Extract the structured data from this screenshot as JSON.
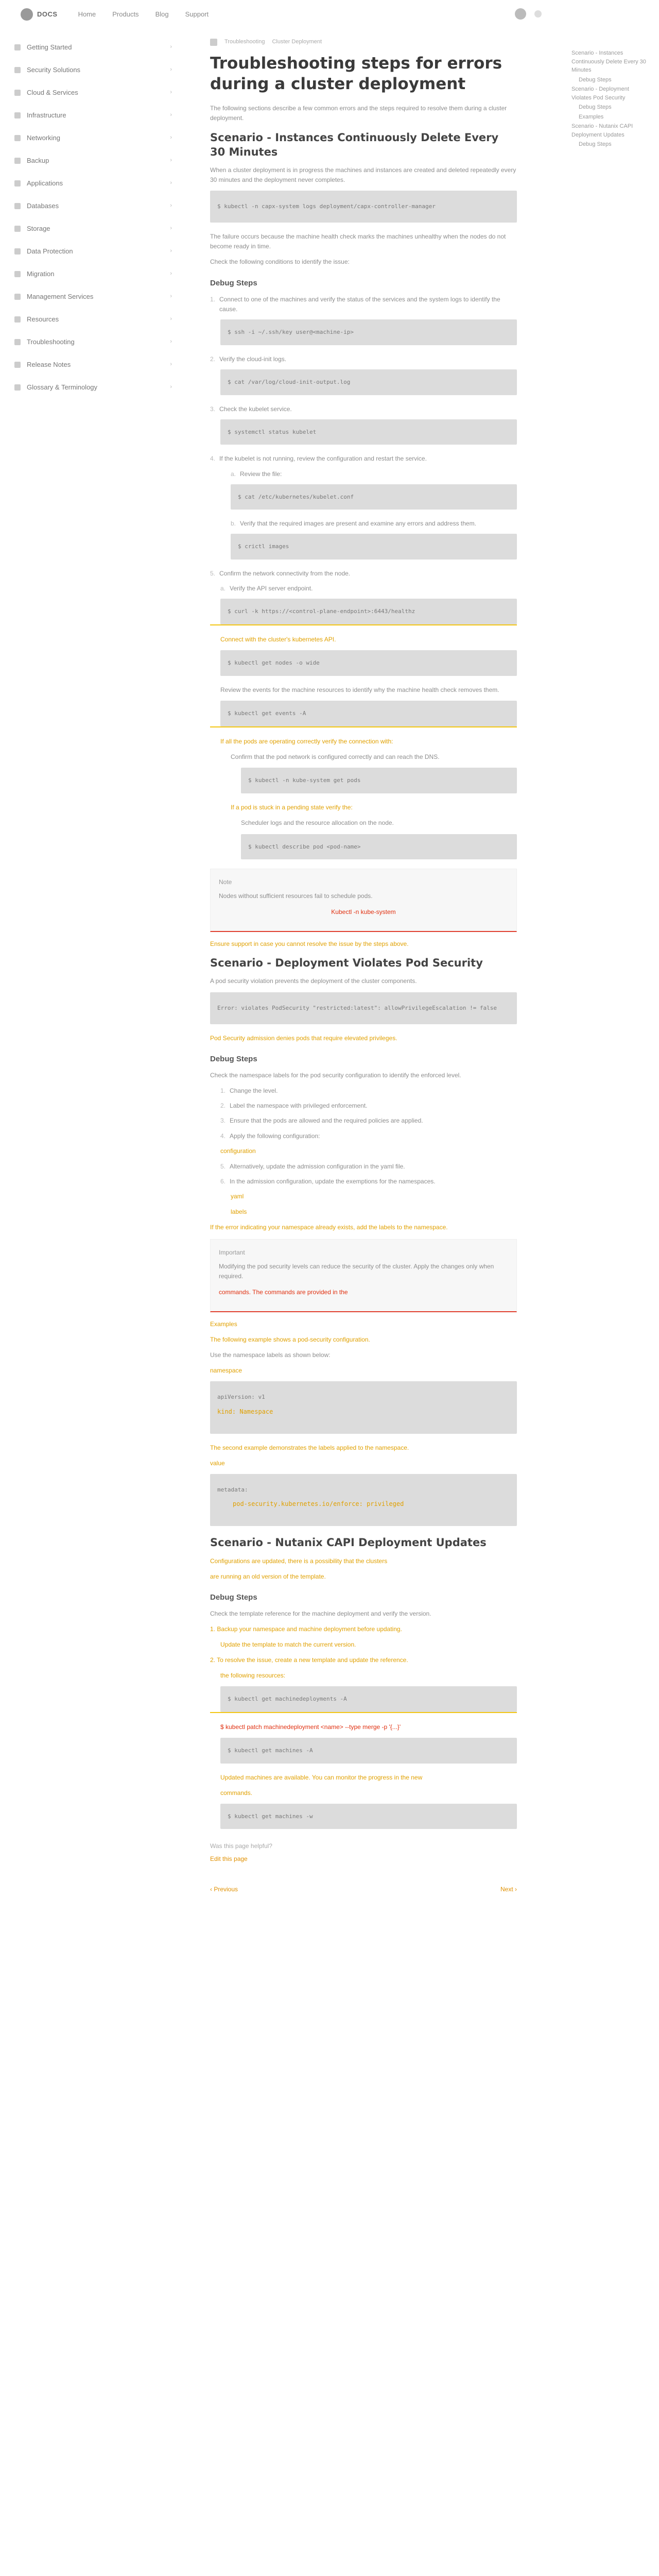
{
  "nav": {
    "brand": "DOCS",
    "links": [
      "Home",
      "Products",
      "Blog",
      "Support"
    ]
  },
  "sidebar": {
    "items": [
      "Getting Started",
      "Security Solutions",
      "Cloud & Services",
      "Infrastructure",
      "Networking",
      "Backup",
      "Applications",
      "Databases",
      "Storage",
      "Data Protection",
      "Migration",
      "Management Services",
      "Resources",
      "Troubleshooting",
      "Release Notes",
      "Glossary & Terminology"
    ]
  },
  "breadcrumb": [
    "Troubleshooting",
    "Cluster Deployment"
  ],
  "page": {
    "title": "Troubleshooting steps for errors during a cluster deployment",
    "intro": "The following sections describe a few common errors and the steps required to resolve them during a cluster deployment.",
    "s1_title": "Scenario - Instances Continuously Delete Every 30 Minutes",
    "s1_p1": "When a cluster deployment is in progress the machines and instances are created and deleted repeatedly every 30 minutes and the deployment never completes.",
    "s1_code1": "$ kubectl -n capx-system logs deployment/capx-controller-manager",
    "s1_p2": "The failure occurs because the machine health check marks the machines unhealthy when the nodes do not become ready in time.",
    "s1_p3": "Check the following conditions to identify the issue:",
    "s1_debug": "Debug Steps",
    "s1_d1": "Connect to one of the machines and verify the status of the services and the system logs to identify the cause.",
    "s1_code2": "$ ssh -i ~/.ssh/key user@<machine-ip>",
    "s1_d2": "Verify the cloud-init logs.",
    "s1_code3": "$ cat /var/log/cloud-init-output.log",
    "s1_d3": "Check the kubelet service.",
    "s1_code4": "$ systemctl status kubelet",
    "s1_d4": "If the kubelet is not running, review the configuration and restart the service.",
    "s1_d5": "Review the file:",
    "s1_code5": "$ cat /etc/kubernetes/kubelet.conf",
    "s1_d6": "Verify that the required images are present and examine any errors and address them.",
    "s1_code6": "$ crictl images",
    "s1_d7": "Confirm the network connectivity from the node.",
    "s1_d8": "Verify the API server endpoint.",
    "s1_code7": "$ curl -k https://<control-plane-endpoint>:6443/healthz",
    "s1_hl1": "Connect with the cluster's kubernetes API.",
    "s1_code8": "$ kubectl get nodes -o wide",
    "s1_d9": "Review the events for the machine resources to identify why the machine health check removes them.",
    "s1_code9": "$ kubectl get events -A",
    "s1_hl2": "If all the pods are operating correctly verify the connection with:",
    "s1_d10": "Confirm that the pod network is configured correctly and can reach the DNS.",
    "s1_code10": "$ kubectl -n kube-system get pods",
    "s1_hl3": "If a pod is stuck in a pending state verify the:",
    "s1_d11": "Scheduler logs and the resource allocation on the node.",
    "s1_code11": "$ kubectl describe pod <pod-name>",
    "s1_note_title": "Note",
    "s1_note": "Nodes without sufficient resources fail to schedule pods.",
    "s1_note_hl": "Kubectl -n kube-system",
    "s1_hl4": "Ensure support in case you cannot resolve the issue by the steps above.",
    "s2_title": "Scenario - Deployment Violates Pod Security",
    "s2_p1": "A pod security violation prevents the deployment of the cluster components.",
    "s2_code1": "Error: violates PodSecurity \"restricted:latest\": allowPrivilegeEscalation != false",
    "s2_hl1": "Pod Security admission denies pods that require elevated privileges.",
    "s2_debug": "Debug Steps",
    "s2_d1": "Check the namespace labels for the pod security configuration to identify the enforced level.",
    "s2_d2": "Change the level.",
    "s2_d3": "Label the namespace with privileged enforcement.",
    "s2_d4": "Ensure that the pods are allowed and the required policies are applied.",
    "s2_d5": "Apply the following configuration:",
    "s2_hl2": "configuration",
    "s2_d6": "Alternatively, update the admission configuration in the yaml file.",
    "s2_d7": "In the admission configuration, update the exemptions for the namespaces.",
    "s2_hl3": "yaml",
    "s2_hl4": "labels",
    "s2_hl5": "If the error indicating your namespace already exists, add the labels to the namespace.",
    "s2_note_title": "Important",
    "s2_note": "Modifying the pod security levels can reduce the security of the cluster. Apply the changes only when required.",
    "s2_note_hl": "commands. The commands are provided in the",
    "s2_hl6": "Examples",
    "s2_hl7": "The following example shows a pod-security configuration.",
    "s2_d8": "Use the namespace labels as shown below:",
    "s2_hl8": "namespace",
    "s2_code2": "apiVersion: v1",
    "s2_code2b": "kind: Namespace",
    "s2_hl9": "The second example demonstrates the labels applied to the namespace.",
    "s2_hl10": "value",
    "s2_code3": "metadata:",
    "s2_code3b": "pod-security.kubernetes.io/enforce: privileged",
    "s3_title": "Scenario - Nutanix CAPI Deployment Updates",
    "s3_hl1": "Configurations are updated, there is a possibility that the clusters",
    "s3_hl2": "are running an old version of the template.",
    "s3_debug": "Debug Steps",
    "s3_d1": "Check the template reference for the machine deployment and verify the version.",
    "s3_hl3": "1. Backup your namespace and machine deployment before updating.",
    "s3_hl4": "Update the template to match the current version.",
    "s3_hl5": "2. To resolve the issue, create a new template and update the reference.",
    "s3_hl6": "the following resources:",
    "s3_code1": "$ kubectl get machinedeployments -A",
    "s3_hl7": "$ kubectl patch machinedeployment <name> --type merge -p '{...}'",
    "s3_code2": "$ kubectl get machines -A",
    "s3_hl8": "Updated machines are available. You can monitor the progress in the new",
    "s3_hl9": "commands.",
    "s3_code3": "$ kubectl get machines -w",
    "feedback_q": "Was this page helpful?",
    "feedback_a": "Edit this page",
    "prev": "‹ Previous",
    "next": "Next ›"
  },
  "toc": {
    "items": [
      "Scenario - Instances Continuously Delete Every 30 Minutes",
      "Debug Steps",
      "Scenario - Deployment Violates Pod Security",
      "Debug Steps",
      "Examples",
      "Scenario - Nutanix CAPI Deployment Updates",
      "Debug Steps"
    ]
  }
}
